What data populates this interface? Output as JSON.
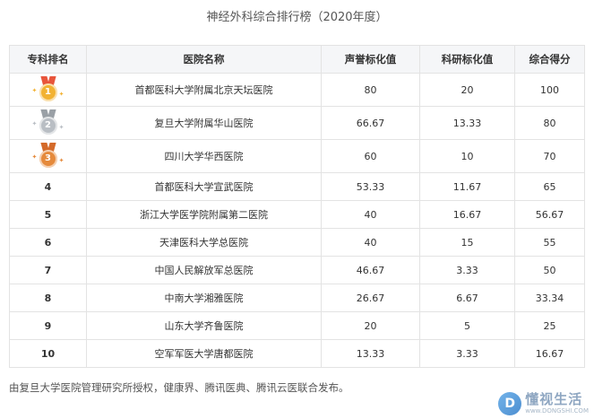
{
  "title": "神经外科综合排行榜（2020年度）",
  "table": {
    "headers": [
      "专科排名",
      "医院名称",
      "声誉标化值",
      "科研标化值",
      "综合得分"
    ],
    "rows": [
      {
        "rank": "1",
        "medal": "gold",
        "name": "首都医科大学附属北京天坛医院",
        "reputation": "80",
        "research": "20",
        "total": "100"
      },
      {
        "rank": "2",
        "medal": "silver",
        "name": "复旦大学附属华山医院",
        "reputation": "66.67",
        "research": "13.33",
        "total": "80"
      },
      {
        "rank": "3",
        "medal": "bronze",
        "name": "四川大学华西医院",
        "reputation": "60",
        "research": "10",
        "total": "70"
      },
      {
        "rank": "4",
        "medal": "",
        "name": "首都医科大学宣武医院",
        "reputation": "53.33",
        "research": "11.67",
        "total": "65"
      },
      {
        "rank": "5",
        "medal": "",
        "name": "浙江大学医学院附属第二医院",
        "reputation": "40",
        "research": "16.67",
        "total": "56.67"
      },
      {
        "rank": "6",
        "medal": "",
        "name": "天津医科大学总医院",
        "reputation": "40",
        "research": "15",
        "total": "55"
      },
      {
        "rank": "7",
        "medal": "",
        "name": "中国人民解放军总医院",
        "reputation": "46.67",
        "research": "3.33",
        "total": "50"
      },
      {
        "rank": "8",
        "medal": "",
        "name": "中南大学湘雅医院",
        "reputation": "26.67",
        "research": "6.67",
        "total": "33.34"
      },
      {
        "rank": "9",
        "medal": "",
        "name": "山东大学齐鲁医院",
        "reputation": "20",
        "research": "5",
        "total": "25"
      },
      {
        "rank": "10",
        "medal": "",
        "name": "空军军医大学唐都医院",
        "reputation": "13.33",
        "research": "3.33",
        "total": "16.67"
      }
    ]
  },
  "medal_colors": {
    "gold": {
      "disc": "#f2b233",
      "ribbon": "#e8553b"
    },
    "silver": {
      "disc": "#b9bec4",
      "ribbon": "#9aa0a6"
    },
    "bronze": {
      "disc": "#e58a3c",
      "ribbon": "#d46a2a"
    }
  },
  "footnote": "由复旦大学医院管理研究所授权，健康界、腾讯医典、腾讯云医联合发布。",
  "watermark": {
    "logo": "D",
    "name": "懂视生活",
    "url": "www.DONGSHI.COM",
    "icon": "dongshi-logo-icon"
  }
}
